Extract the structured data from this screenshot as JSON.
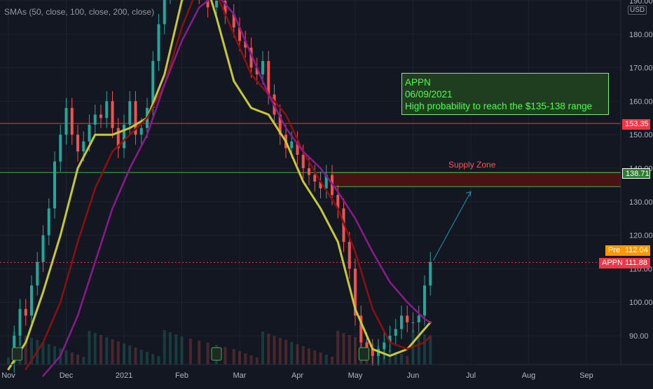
{
  "indicator": {
    "label": "SMAs (50, close, 100, close, 200, close)"
  },
  "note": {
    "line1": "APPN",
    "line2": "06/09/2021",
    "line3": "High probability to reach the $135-138 range"
  },
  "zone": {
    "label": "Supply Zone"
  },
  "currency": "USD",
  "price_tags": {
    "resistance": "153.35",
    "supply": "138.71",
    "pre_label": "Pre",
    "pre_value": "112.04",
    "ticker": "APPN",
    "last_value": "111.88"
  },
  "colors": {
    "background": "#131722",
    "sma50": "#c8c832",
    "sma100": "#8b1010",
    "sma200": "#8b1a8b",
    "resistance": "#f23645",
    "supply_line": "#4caf50",
    "up": "#26a69a",
    "down": "#ef5350"
  },
  "chart_data": {
    "type": "line",
    "title": "APPN",
    "y_ticks": [
      190,
      180,
      170,
      160,
      150,
      140,
      130,
      120,
      110,
      100,
      90
    ],
    "x_ticks": [
      "Nov",
      "Dec",
      "2021",
      "Feb",
      "Mar",
      "Apr",
      "May",
      "Jun",
      "Jul",
      "Aug",
      "Sep"
    ],
    "ylim": [
      82,
      193
    ],
    "x_unit": "months since 2020-11-01",
    "series": [
      {
        "name": "Price",
        "color": "#26a69a",
        "x": [
          0.0,
          0.1,
          0.2,
          0.3,
          0.4,
          0.5,
          0.6,
          0.7,
          0.8,
          0.9,
          1.0,
          1.1,
          1.2,
          1.3,
          1.4,
          1.5,
          1.6,
          1.7,
          1.8,
          1.9,
          2.0,
          2.1,
          2.2,
          2.3,
          2.4,
          2.5,
          2.6,
          2.7,
          2.8,
          2.9,
          3.0,
          3.15,
          3.3,
          3.45,
          3.6,
          3.75,
          3.9,
          4.0,
          4.1,
          4.2,
          4.3,
          4.4,
          4.5,
          4.6,
          4.7,
          4.8,
          4.9,
          5.0,
          5.1,
          5.2,
          5.3,
          5.4,
          5.5,
          5.6,
          5.7,
          5.8,
          5.9,
          6.0,
          6.1,
          6.2,
          6.3,
          6.4,
          6.5,
          6.6,
          6.7,
          6.8,
          6.9,
          7.0,
          7.1,
          7.2,
          7.3
        ],
        "values": [
          82,
          90,
          98,
          96,
          105,
          112,
          120,
          128,
          142,
          150,
          158,
          150,
          145,
          148,
          153,
          156,
          155,
          160,
          152,
          146,
          153,
          160,
          150,
          152,
          158,
          172,
          183,
          192,
          200,
          205,
          208,
          198,
          192,
          188,
          190,
          186,
          182,
          178,
          176,
          170,
          168,
          172,
          162,
          156,
          150,
          146,
          148,
          144,
          140,
          138,
          136,
          134,
          138,
          132,
          128,
          118,
          110,
          96,
          88,
          86,
          84,
          86,
          88,
          90,
          92,
          96,
          94,
          94,
          96,
          105,
          112
        ]
      },
      {
        "name": "SMA 50",
        "color": "#c8c832",
        "x": [
          0.0,
          0.3,
          0.6,
          0.9,
          1.2,
          1.5,
          1.8,
          2.1,
          2.4,
          2.7,
          3.0,
          3.3,
          3.6,
          3.9,
          4.2,
          4.5,
          4.8,
          5.1,
          5.4,
          5.7,
          6.0,
          6.3,
          6.6,
          6.9,
          7.2,
          7.3
        ],
        "values": [
          80,
          88,
          103,
          120,
          140,
          150,
          150,
          152,
          155,
          168,
          190,
          202,
          185,
          166,
          158,
          156,
          148,
          136,
          128,
          118,
          98,
          86,
          84,
          86,
          92,
          94
        ]
      },
      {
        "name": "SMA 100",
        "color": "#8b1010",
        "x": [
          0.3,
          0.6,
          0.9,
          1.2,
          1.5,
          1.8,
          2.1,
          2.4,
          2.7,
          3.0,
          3.3,
          3.6,
          3.9,
          4.2,
          4.5,
          4.8,
          5.1,
          5.4,
          5.7,
          6.0,
          6.3,
          6.6,
          6.9,
          7.2,
          7.3
        ],
        "values": [
          80,
          88,
          100,
          118,
          134,
          145,
          150,
          155,
          165,
          182,
          195,
          192,
          180,
          168,
          162,
          156,
          145,
          136,
          128,
          115,
          98,
          88,
          86,
          88,
          90
        ]
      },
      {
        "name": "SMA 200",
        "color": "#8b1a8b",
        "x": [
          0.6,
          0.9,
          1.2,
          1.5,
          1.8,
          2.1,
          2.4,
          2.7,
          3.0,
          3.3,
          3.6,
          3.9,
          4.2,
          4.5,
          4.8,
          5.1,
          5.4,
          5.7,
          6.0,
          6.3,
          6.6,
          6.9,
          7.2,
          7.3
        ],
        "values": [
          78,
          84,
          96,
          112,
          128,
          140,
          150,
          165,
          178,
          188,
          192,
          186,
          174,
          162,
          152,
          145,
          140,
          133,
          125,
          115,
          106,
          100,
          95,
          94
        ]
      }
    ],
    "hlines": [
      {
        "label": "153.35",
        "value": 153.35,
        "color": "#f23645"
      },
      {
        "label": "138.71",
        "value": 138.71,
        "color": "#4caf50"
      },
      {
        "label": "111.88",
        "value": 111.88,
        "color": "#f23645",
        "style": "dotted"
      }
    ],
    "zone": {
      "label": "Supply Zone",
      "low": 134.5,
      "high": 138.7,
      "start_x": 5.6
    }
  }
}
